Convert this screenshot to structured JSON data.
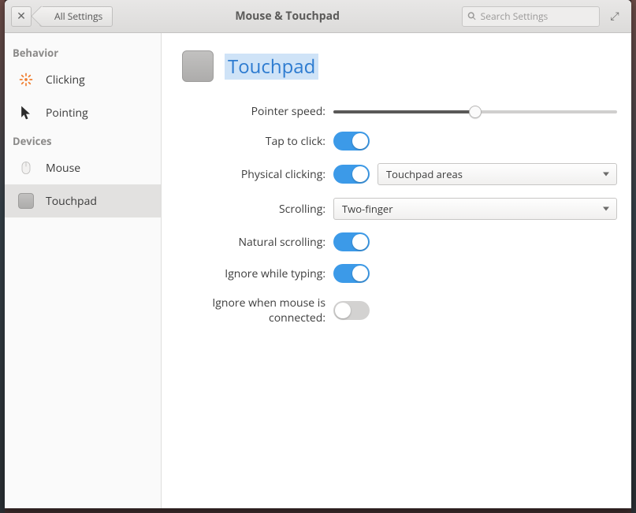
{
  "titlebar": {
    "back_label": "All Settings",
    "title": "Mouse & Touchpad",
    "search_placeholder": "Search Settings"
  },
  "sidebar": {
    "groups": [
      {
        "header": "Behavior",
        "items": [
          {
            "id": "clicking",
            "label": "Clicking"
          },
          {
            "id": "pointing",
            "label": "Pointing"
          }
        ]
      },
      {
        "header": "Devices",
        "items": [
          {
            "id": "mouse",
            "label": "Mouse"
          },
          {
            "id": "touchpad",
            "label": "Touchpad",
            "active": true
          }
        ]
      }
    ]
  },
  "main": {
    "title": "Touchpad",
    "pointer_speed": {
      "label": "Pointer speed:",
      "value": 50,
      "min": 0,
      "max": 100
    },
    "tap_to_click": {
      "label": "Tap to click:",
      "value": true
    },
    "physical_clicking": {
      "label": "Physical clicking:",
      "enabled": true,
      "selected": "Touchpad areas"
    },
    "scrolling": {
      "label": "Scrolling:",
      "selected": "Two-finger"
    },
    "natural_scrolling": {
      "label": "Natural scrolling:",
      "value": true
    },
    "ignore_typing": {
      "label": "Ignore while typing:",
      "value": true
    },
    "ignore_mouse": {
      "label": "Ignore when mouse is connected:",
      "value": false
    }
  },
  "colors": {
    "accent": "#3c9ae8",
    "link": "#2d7bd0"
  }
}
